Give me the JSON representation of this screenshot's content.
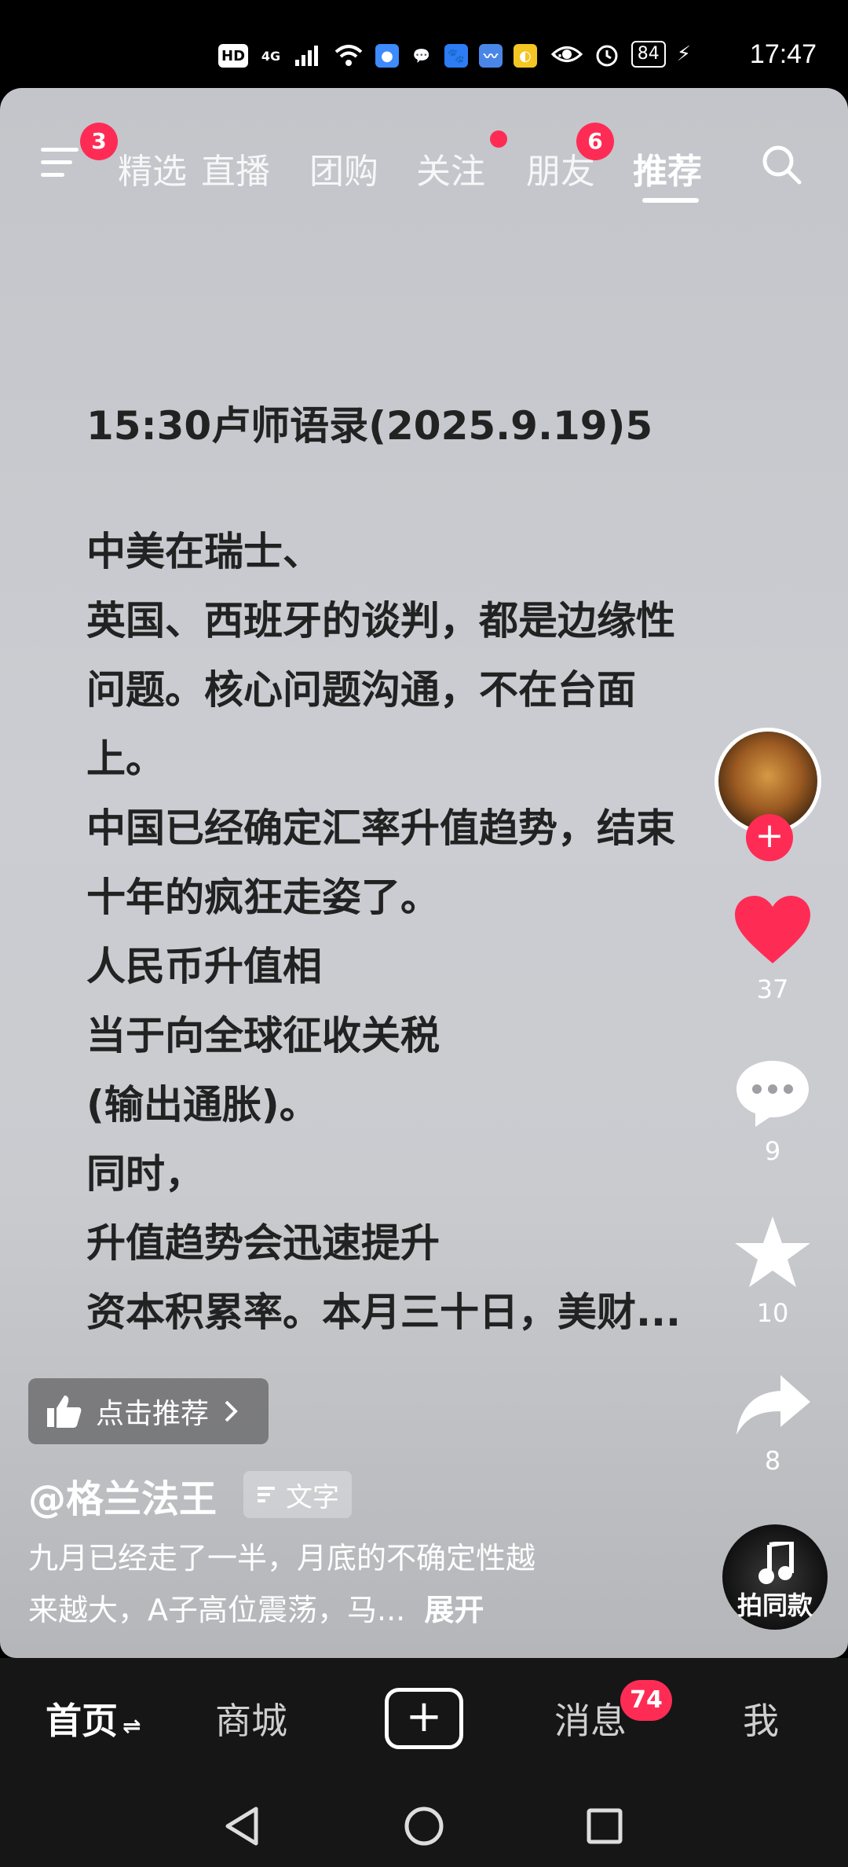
{
  "status_bar": {
    "time": "17:47",
    "battery": "84",
    "network": "4G",
    "hd": "HD",
    "more": "···"
  },
  "top_nav": {
    "menu_badge": "3",
    "tabs": [
      {
        "label": "精选"
      },
      {
        "label": "直播"
      },
      {
        "label": "团购"
      },
      {
        "label": "关注"
      },
      {
        "label": "朋友",
        "badge": "6"
      },
      {
        "label": "推荐",
        "active": true
      }
    ]
  },
  "post": {
    "title": "15:30卢师语录(2025.9.19)5",
    "lines": [
      "中美在瑞士、",
      "英国、西班牙的谈判，都是边缘性",
      "问题。核心问题沟通，不在台面",
      "上。",
      "中国已经确定汇率升值趋势，结束",
      "十年的疯狂走姿了。",
      "人民币升值相",
      "当于向全球征收关税",
      "(输出通胀)。",
      "同时，",
      "升值趋势会迅速提升",
      "资本积累率。本月三十日，美财..."
    ]
  },
  "actions": {
    "likes": "37",
    "comments": "9",
    "favorites": "10",
    "shares": "8"
  },
  "recommend": {
    "label": "点击推荐"
  },
  "author": {
    "name": "@格兰法王",
    "tag": "文字"
  },
  "description": {
    "line1": "九月已经走了一半，月底的不确定性越",
    "line2": "来越大，A子高位震荡，马...",
    "expand": "展开"
  },
  "music": {
    "label": "拍同款"
  },
  "bottom_nav": {
    "home": "首页",
    "mall": "商城",
    "plus": "+",
    "messages": "消息",
    "messages_badge": "74",
    "me": "我"
  },
  "colors": {
    "accent": "#fe2c55",
    "like": "#fe2c55",
    "card_bg": "#c8cacf",
    "nav_bg": "#161616"
  }
}
